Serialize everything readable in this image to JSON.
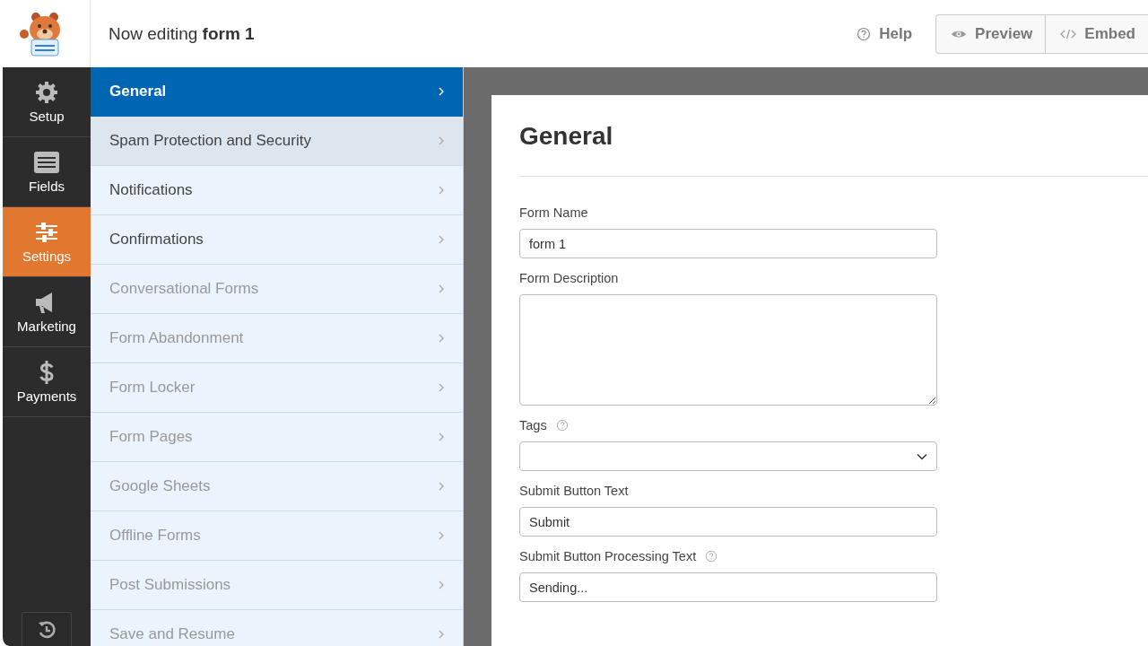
{
  "header": {
    "title_prefix": "Now editing",
    "title_form": "form 1",
    "help": "Help",
    "buttons": [
      {
        "kind": "preview",
        "label": "Preview"
      },
      {
        "kind": "embed",
        "label": "Embed"
      }
    ]
  },
  "rail": [
    {
      "kind": "setup",
      "label": "Setup",
      "selected": false
    },
    {
      "kind": "fields",
      "label": "Fields",
      "selected": false
    },
    {
      "kind": "settings",
      "label": "Settings",
      "selected": true
    },
    {
      "kind": "marketing",
      "label": "Marketing",
      "selected": false
    },
    {
      "kind": "payments",
      "label": "Payments",
      "selected": false
    }
  ],
  "panel": [
    {
      "label": "General",
      "selected": true,
      "hovered": false,
      "disabled": false
    },
    {
      "label": "Spam Protection and Security",
      "selected": false,
      "hovered": true,
      "disabled": false
    },
    {
      "label": "Notifications",
      "selected": false,
      "hovered": false,
      "disabled": false
    },
    {
      "label": "Confirmations",
      "selected": false,
      "hovered": false,
      "disabled": false
    },
    {
      "label": "Conversational Forms",
      "selected": false,
      "hovered": false,
      "disabled": true
    },
    {
      "label": "Form Abandonment",
      "selected": false,
      "hovered": false,
      "disabled": true
    },
    {
      "label": "Form Locker",
      "selected": false,
      "hovered": false,
      "disabled": true
    },
    {
      "label": "Form Pages",
      "selected": false,
      "hovered": false,
      "disabled": true
    },
    {
      "label": "Google Sheets",
      "selected": false,
      "hovered": false,
      "disabled": true
    },
    {
      "label": "Offline Forms",
      "selected": false,
      "hovered": false,
      "disabled": true
    },
    {
      "label": "Post Submissions",
      "selected": false,
      "hovered": false,
      "disabled": true
    },
    {
      "label": "Save and Resume",
      "selected": false,
      "hovered": false,
      "disabled": true
    }
  ],
  "content": {
    "heading": "General",
    "fields": [
      {
        "kind": "text",
        "label": "Form Name",
        "help": false,
        "value": "form 1"
      },
      {
        "kind": "textarea",
        "label": "Form Description",
        "help": false
      },
      {
        "kind": "select",
        "label": "Tags",
        "help": true
      },
      {
        "kind": "text",
        "label": "Submit Button Text",
        "help": false,
        "value": "Submit"
      },
      {
        "kind": "text",
        "label": "Submit Button Processing Text",
        "help": true,
        "value": "Sending..."
      }
    ]
  }
}
